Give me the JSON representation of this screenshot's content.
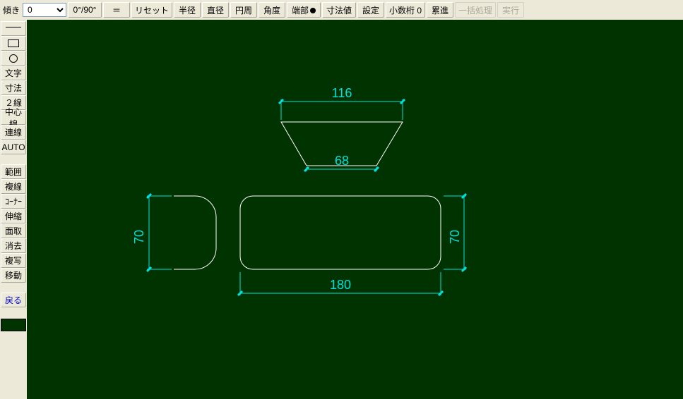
{
  "toolbar": {
    "tilt_label": "傾き",
    "tilt_value": "0",
    "degree_label": "0°/90°",
    "equal_label": "＝",
    "reset_label": "リセット",
    "radius_label": "半径",
    "diameter_label": "直径",
    "circumference_label": "円周",
    "angle_label": "角度",
    "endpoint_label": "端部",
    "dim_value_label": "寸法値",
    "settings_label": "設定",
    "decimal_label": "小数桁 0",
    "incremental_label": "累進",
    "batch_label": "一括処理",
    "execute_label": "実行"
  },
  "sidebar": {
    "text_label": "文字",
    "dim_label": "寸法",
    "twoline_label": "２線",
    "centerline_label": "中心線",
    "polyline_label": "連線",
    "auto_label": "AUTO",
    "range_label": "範囲",
    "multiline_label": "複線",
    "corner_label": "ｺｰﾅｰ",
    "stretch_label": "伸縮",
    "chamfer_label": "面取",
    "erase_label": "消去",
    "copy_label": "複写",
    "move_label": "移動",
    "return_label": "戻る"
  },
  "dimensions": {
    "top_width": "116",
    "bottom_width": "68",
    "left_height": "70",
    "right_height": "70",
    "main_width": "180"
  }
}
